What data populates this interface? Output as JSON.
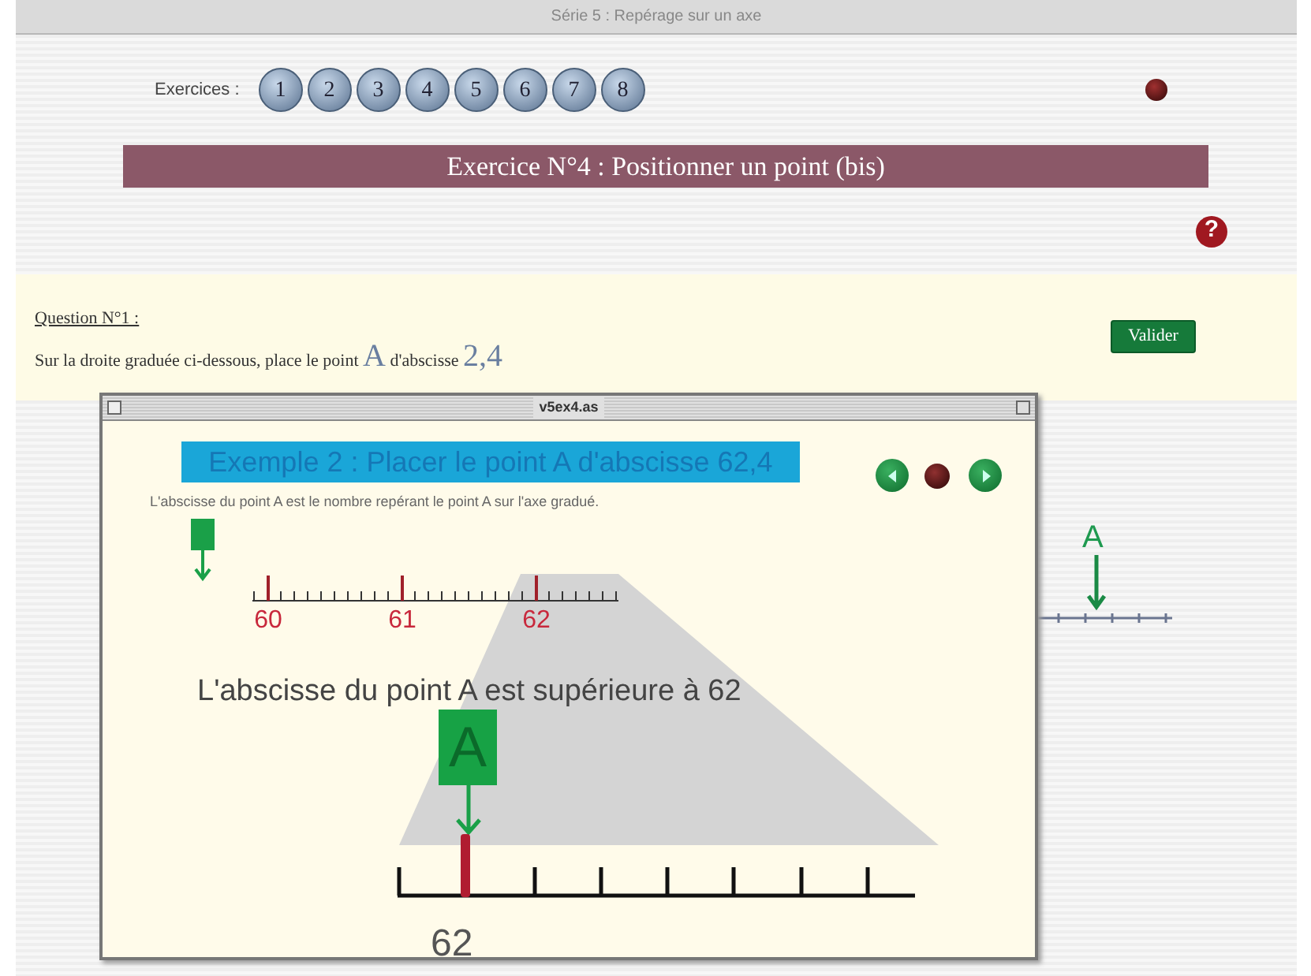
{
  "window": {
    "title": "Série 5 : Repérage sur un axe"
  },
  "exercises": {
    "label": "Exercices :",
    "items": [
      "1",
      "2",
      "3",
      "4",
      "5",
      "6",
      "7",
      "8"
    ]
  },
  "banner": "Exercice N°4 : Positionner un point (bis)",
  "help": {
    "label": "?"
  },
  "question": {
    "heading": "Question N°1 :",
    "parts": [
      {
        "kind": "plain",
        "text": "Sur la droite graduée ci-dessous, place le point "
      },
      {
        "kind": "large",
        "text": "A"
      },
      {
        "kind": "plain",
        "text": " d'abscisse "
      },
      {
        "kind": "large",
        "text": "2,4"
      }
    ]
  },
  "validate_button": "Valider",
  "background_axis": {
    "point_label": "A"
  },
  "popup": {
    "title": "v5ex4.as",
    "heading": "Exemple 2 : Placer le point A d'abscisse 62,4",
    "definition": "L'abscisse du point A est le nombre repérant le point A sur l'axe gradué.",
    "ruler_labels": [
      "60",
      "61",
      "62"
    ],
    "statement": "L'abscisse du point A est supérieure à 62",
    "marker_label": "A",
    "zoom_label": "62"
  }
}
